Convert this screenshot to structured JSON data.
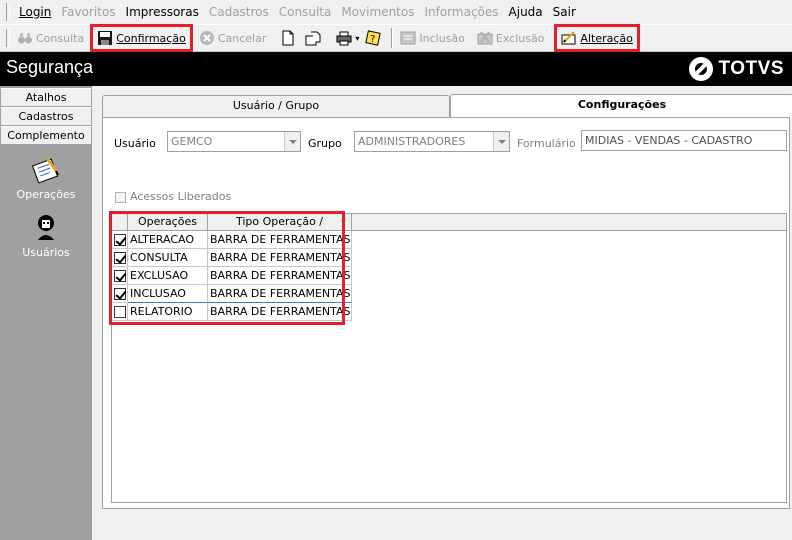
{
  "menu": {
    "items": [
      {
        "label": "Login",
        "enabled": true
      },
      {
        "label": "Favoritos",
        "enabled": false
      },
      {
        "label": "Impressoras",
        "enabled": true
      },
      {
        "label": "Cadastros",
        "enabled": false
      },
      {
        "label": "Consulta",
        "enabled": false
      },
      {
        "label": "Movimentos",
        "enabled": false
      },
      {
        "label": "Informações",
        "enabled": false
      },
      {
        "label": "Ajuda",
        "enabled": true
      },
      {
        "label": "Sair",
        "enabled": true
      }
    ]
  },
  "toolbar": {
    "consulta": "Consulta",
    "confirmacao": "Confirmação",
    "cancelar": "Cancelar",
    "inclusao": "Inclusão",
    "exclusao": "Exclusão",
    "alteracao": "Alteração"
  },
  "header": {
    "title": "Segurança",
    "brand": "TOTVS"
  },
  "sidebar": {
    "tabs": [
      "Atalhos",
      "Cadastros",
      "Complemento"
    ],
    "items": [
      {
        "label": "Operações",
        "icon": "operations-icon"
      },
      {
        "label": "Usuários",
        "icon": "users-icon"
      }
    ]
  },
  "tabs": {
    "usuario_grupo": "Usuário  / Grupo",
    "configuracoes": "Configurações"
  },
  "form": {
    "usuario_label": "Usuário",
    "usuario_value": "GEMCO",
    "grupo_label": "Grupo",
    "grupo_value": "ADMINISTRADORES",
    "formulario_label": "Formulário",
    "formulario_value": "MIDIAS - VENDAS - CADASTRO",
    "acessos_label": "Acessos Liberados"
  },
  "grid": {
    "columns": [
      "Operações",
      "Tipo Operação  /"
    ],
    "rows": [
      {
        "checked": true,
        "operacao": "ALTERACAO",
        "tipo": "BARRA DE FERRAMENTAS"
      },
      {
        "checked": true,
        "operacao": "CONSULTA",
        "tipo": "BARRA DE FERRAMENTAS"
      },
      {
        "checked": true,
        "operacao": "EXCLUSAO",
        "tipo": "BARRA DE FERRAMENTAS"
      },
      {
        "checked": true,
        "operacao": "INCLUSAO",
        "tipo": "BARRA DE FERRAMENTAS"
      },
      {
        "checked": false,
        "operacao": "RELATORIO",
        "tipo": "BARRA DE FERRAMENTAS"
      }
    ]
  },
  "colors": {
    "highlight": "#e0202a",
    "header_bg": "#000000",
    "sidebar_bg": "#a0a0a0"
  }
}
